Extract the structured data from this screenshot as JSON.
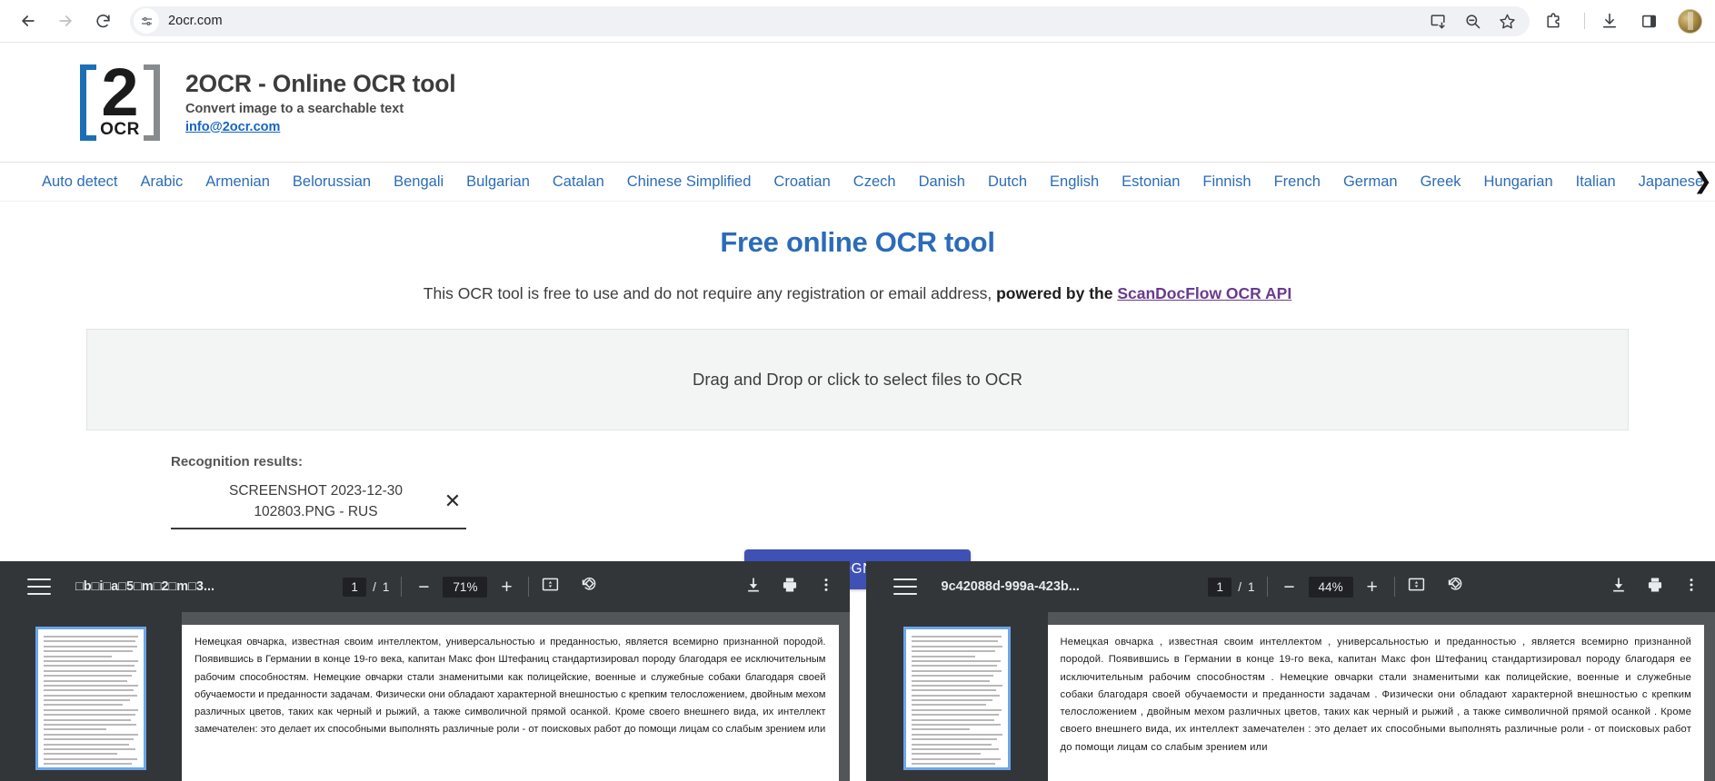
{
  "browser": {
    "url": "2ocr.com",
    "nav": {
      "back": "back-arrow",
      "forward": "forward-arrow",
      "reload": "reload-icon",
      "site_info": "site-settings-icon"
    },
    "toolbar_icons": [
      "install-app-icon",
      "zoom-out-icon",
      "bookmark-star-icon",
      "extensions-puzzle-icon",
      "downloads-icon",
      "side-panel-icon",
      "profile-avatar"
    ]
  },
  "header": {
    "logo_digit": "2",
    "logo_word": "OCR",
    "title": "2OCR - Online OCR tool",
    "subtitle": "Convert image to a searchable text",
    "email": "info@2ocr.com"
  },
  "languages": [
    "Auto detect",
    "Arabic",
    "Armenian",
    "Belorussian",
    "Bengali",
    "Bulgarian",
    "Catalan",
    "Chinese Simplified",
    "Croatian",
    "Czech",
    "Danish",
    "Dutch",
    "English",
    "Estonian",
    "Finnish",
    "French",
    "German",
    "Greek",
    "Hungarian",
    "Italian",
    "Japanese"
  ],
  "lang_next_arrow": "❯",
  "main": {
    "title": "Free online OCR tool",
    "desc_part1": "This OCR tool is free to use and do not require any registration or email address, ",
    "desc_bold": "powered by the ",
    "desc_link": "ScanDocFlow OCR API",
    "dropzone_text": "Drag and Drop or click to select files to OCR"
  },
  "results": {
    "label": "Recognition results:",
    "file_name": "SCREENSHOT 2023-12-30 102803.PNG - RUS",
    "close_glyph": "✕",
    "save_button": "SAVE RECOGNIZED TEXT"
  },
  "viewers": [
    {
      "filename": "□b□i□a□5□m□2□m□3...",
      "page_current": "1",
      "page_sep": "/",
      "page_total": "1",
      "zoom_out": "−",
      "zoom_level": "71%",
      "zoom_in": "+",
      "fit_icon": "fit-to-page-icon",
      "rotate_icon": "rotate-icon",
      "download_icon": "download-icon",
      "print_icon": "print-icon",
      "more_icon": "more-options-icon",
      "doc_text": "Немецкая овчарка, известная своим интеллектом, универсальностью и преданностью, является всемирно признанной породой. Появившись в Германии в конце 19-го века, капитан Макс фон Штефаниц стандартизировал породу благодаря ее исключительным рабочим способностям. Немецкие овчарки стали знаменитыми как полицейские, военные и служебные собаки благодаря своей обучаемости и преданности задачам. Физически они обладают характерной внешностью с крепким телосложением, двойным мехом различных цветов, таких как черный и рыжий, а также символичной прямой осанкой. Кроме своего внешнего вида, их интеллект замечателен: это делает их способными выполнять различные роли - от поисковых работ до помощи лицам со слабым зрением или"
    },
    {
      "filename": "9c42088d-999a-423b...",
      "page_current": "1",
      "page_sep": "/",
      "page_total": "1",
      "zoom_out": "−",
      "zoom_level": "44%",
      "zoom_in": "+",
      "fit_icon": "fit-to-page-icon",
      "rotate_icon": "rotate-icon",
      "download_icon": "download-icon",
      "print_icon": "print-icon",
      "more_icon": "more-options-icon",
      "doc_text": "Немецкая овчарка , известная своим интеллектом , универсальностью и преданностью , является всемирно признанной породой. Появившись в Германии в конце 19-го века, капитан Макс фон Штефаниц стандартизировал породу благодаря ее исключительным рабочим способностям . Немецкие овчарки стали знаменитыми как полицейские, военные и служебные собаки благодаря своей обучаемости и преданности задачам . Физически они обладают характерной внешностью с крепким телосложением , двойным мехом различных цветов, таких как черный и рыжий , а также символичной прямой осанкой . Кроме своего внешнего вида, их интеллект замечателен : это делает их способными выполнять различные роли - от поисковых работ до помощи лицам со слабым зрением или"
    }
  ],
  "colors": {
    "link_blue": "#2b6cb8",
    "accent_button": "#3f51b5",
    "visited_link": "#6a3a8e",
    "pdf_toolbar": "#323639",
    "pdf_background": "#525659"
  }
}
